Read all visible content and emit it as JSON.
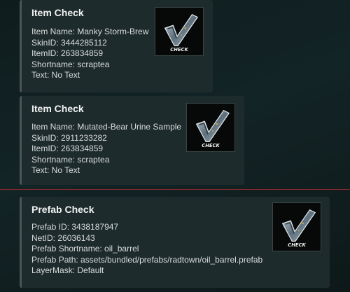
{
  "cards": [
    {
      "title": "Item Check",
      "fields": [
        "Item Name: Manky Storm-Brew",
        "SkinID: 3444285112",
        "ItemID: 263834859",
        "Shortname: scraptea",
        "Text: No Text"
      ],
      "icon": "check-badge-icon",
      "badge_text": "CHECK"
    },
    {
      "title": "Item Check",
      "fields": [
        "Item Name: Mutated-Bear Urine Sample",
        "SkinID: 2911233282",
        "ItemID: 263834859",
        "Shortname: scraptea",
        "Text: No Text"
      ],
      "icon": "check-badge-icon",
      "badge_text": "CHECK"
    },
    {
      "title": "Prefab Check",
      "fields": [
        "Prefab ID: 3438187947",
        "NetID: 26036143",
        "Prefab Shortname: oil_barrel",
        "Prefab Path: assets/bundled/prefabs/radtown/oil_barrel.prefab",
        "LayerMask: Default"
      ],
      "icon": "check-badge-icon",
      "badge_text": "CHECK"
    }
  ],
  "colors": {
    "card_bg": "#1e2b2c",
    "divider": "#8c2a30",
    "title": "#f0f2f2",
    "text": "#d7dcdc"
  }
}
